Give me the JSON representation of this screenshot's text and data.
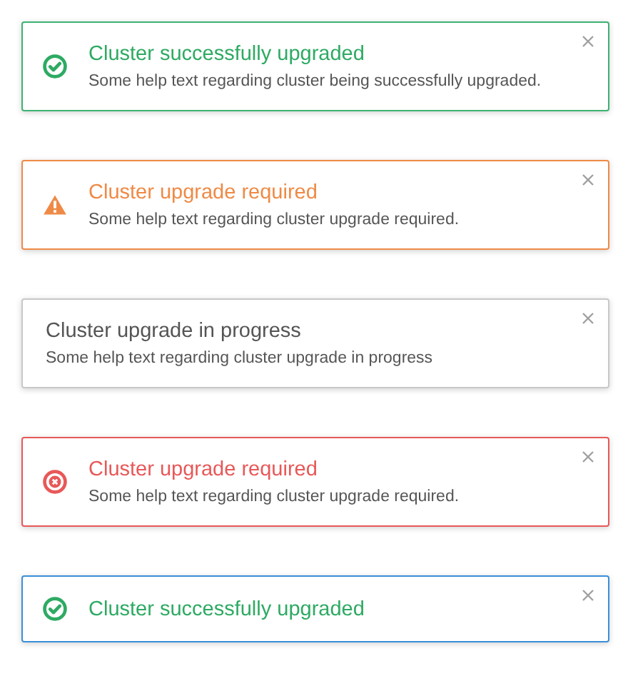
{
  "alerts": [
    {
      "kind": "success",
      "focused": false,
      "title": "Cluster successfully upgraded",
      "text": "Some help text regarding cluster being successfully upgraded."
    },
    {
      "kind": "warning",
      "focused": false,
      "title": "Cluster upgrade required",
      "text": "Some help text regarding cluster upgrade required."
    },
    {
      "kind": "info",
      "focused": false,
      "title": "Cluster upgrade in progress",
      "text": "Some help text regarding cluster upgrade in progress"
    },
    {
      "kind": "error",
      "focused": false,
      "title": "Cluster upgrade required",
      "text": "Some help text regarding cluster upgrade required."
    },
    {
      "kind": "success",
      "focused": true,
      "title": "Cluster successfully upgraded"
    }
  ]
}
